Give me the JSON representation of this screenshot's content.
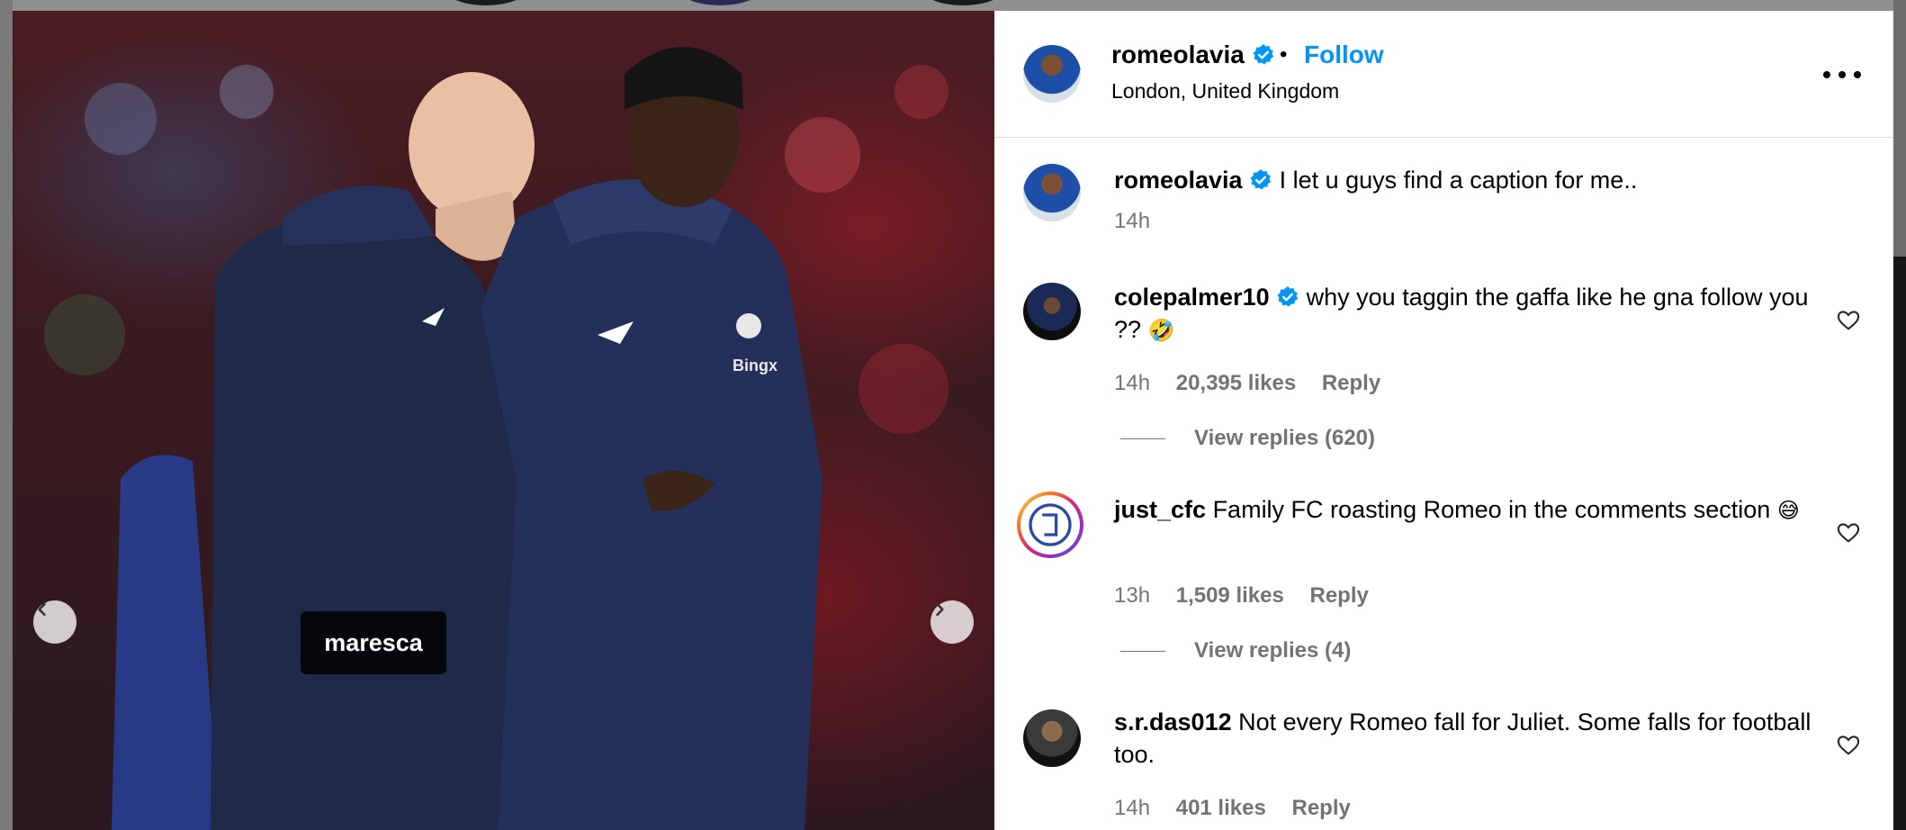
{
  "photo": {
    "tag": "maresca",
    "brand_text": "Bingx"
  },
  "post": {
    "username": "romeolavia",
    "follow_label": "Follow",
    "separator": "•",
    "location": "London, United Kingdom",
    "caption": "I let u guys find a caption for me..",
    "caption_time": "14h"
  },
  "comments": [
    {
      "username": "colepalmer10",
      "verified": true,
      "text": "why you taggin the gaffa like he gna follow you ??",
      "emoji": "🤣",
      "time": "14h",
      "likes": "20,395 likes",
      "reply_label": "Reply",
      "view_replies": "View replies (620)"
    },
    {
      "username": "just_cfc",
      "verified": false,
      "text": "Family FC roasting Romeo in the comments section",
      "emoji": "😅",
      "time": "13h",
      "likes": "1,509 likes",
      "reply_label": "Reply",
      "view_replies": "View replies (4)"
    },
    {
      "username": "s.r.das012",
      "verified": false,
      "text": "Not every Romeo fall for Juliet. Some falls for football too.",
      "time": "14h",
      "likes": "401 likes",
      "reply_label": "Reply"
    }
  ],
  "colors": {
    "follow": "#0095f6",
    "verified": "#0095f6",
    "meta_gray": "#737373"
  },
  "icons": [
    "chevron-left-icon",
    "chevron-right-icon",
    "verified-badge-icon",
    "more-options-icon",
    "heart-icon"
  ]
}
